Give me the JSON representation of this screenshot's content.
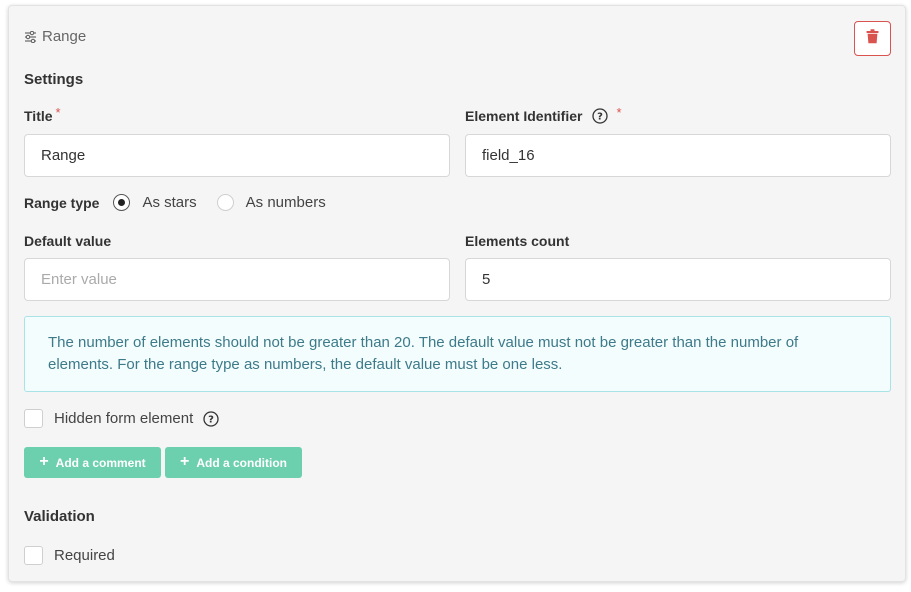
{
  "header": {
    "title": "Range",
    "icon": "sliders-icon"
  },
  "delete_icon": "trash-icon",
  "settings": {
    "heading": "Settings",
    "title_field": {
      "label": "Title",
      "required_mark": "*",
      "value": "Range"
    },
    "identifier_field": {
      "label": "Element Identifier",
      "required_mark": "*",
      "value": "field_16"
    },
    "range_type": {
      "label": "Range type",
      "options": [
        "As stars",
        "As numbers"
      ],
      "selected": "As stars"
    },
    "default_value": {
      "label": "Default value",
      "placeholder": "Enter value",
      "value": ""
    },
    "elements_count": {
      "label": "Elements count",
      "value": "5"
    },
    "info_text": "The number of elements should not be greater than 20. The default value must not be greater than the number of elements. For the range type as numbers, the default value must be one less.",
    "hidden_checkbox": {
      "label": "Hidden form element",
      "checked": false
    },
    "buttons": {
      "add_comment": "Add a comment",
      "add_condition": "Add a condition"
    }
  },
  "validation": {
    "heading": "Validation",
    "required_checkbox": {
      "label": "Required",
      "checked": false
    }
  },
  "colors": {
    "accent_green": "#6ccfae",
    "danger": "#d9534f",
    "info_border": "#a9e3e8",
    "info_text": "#3d7a8a"
  }
}
